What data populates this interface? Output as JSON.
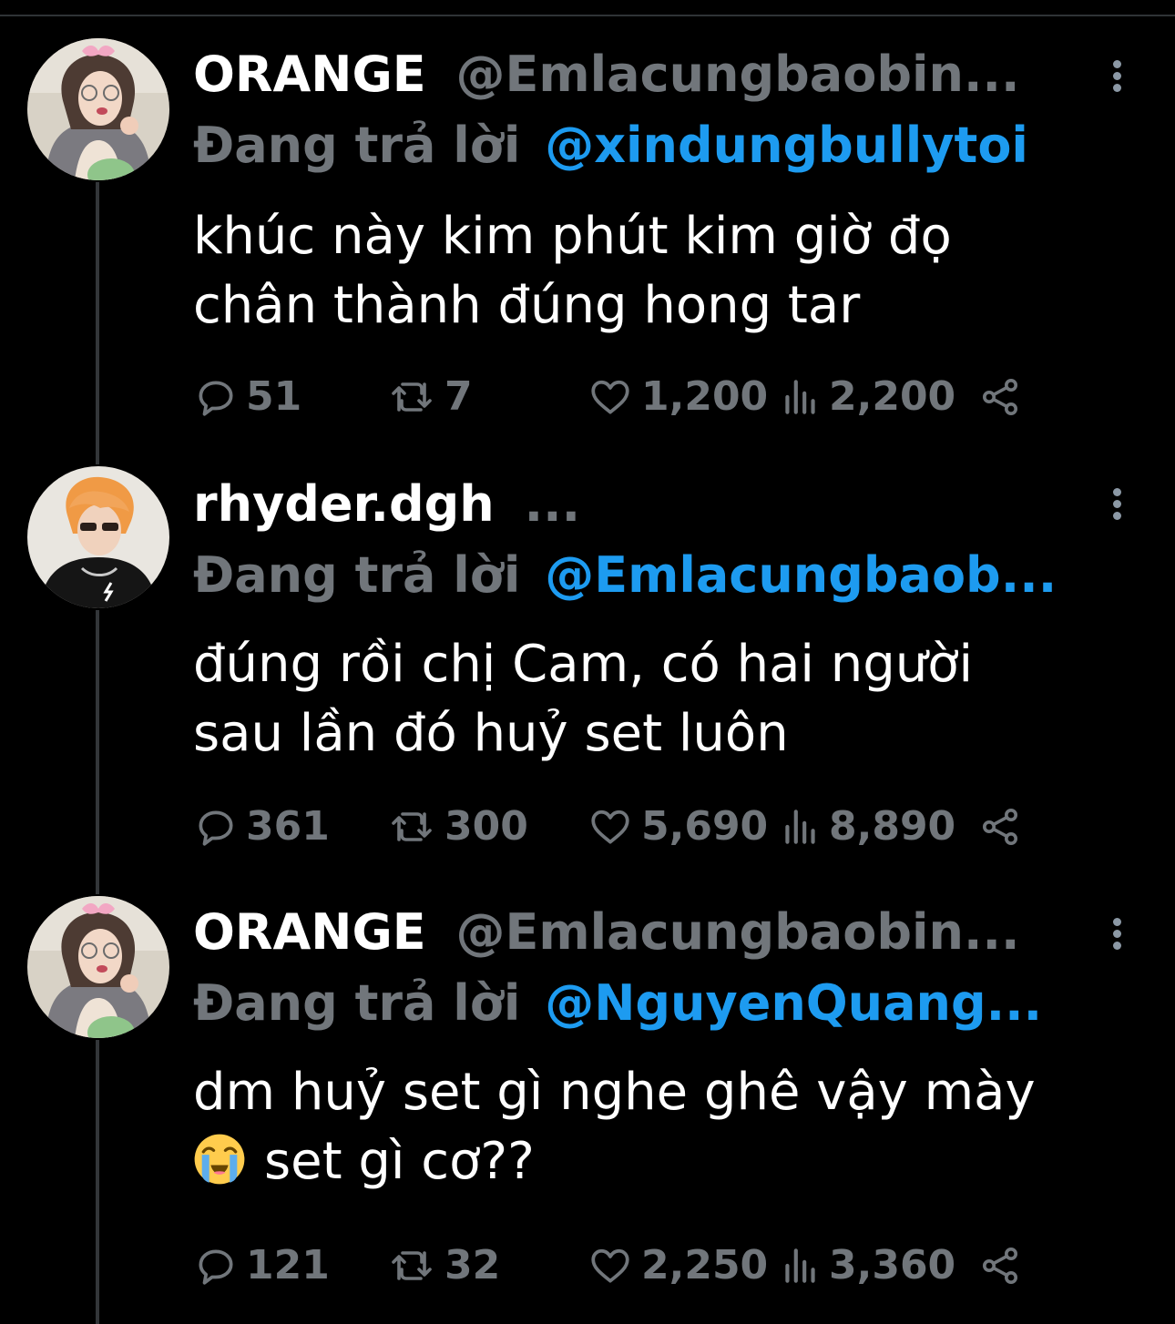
{
  "tweets": [
    {
      "display_name": "ORANGE",
      "handle": "@Emlacungbaobin...",
      "reply_prefix": "Đang trả lời",
      "reply_to": "@xindungbullytoi",
      "text_line1": "khúc này kim phút kim giờ đọ",
      "text_line2": "chân thành đúng hong tar",
      "replies": "51",
      "retweets": "7",
      "likes": "1,200",
      "views": "2,200"
    },
    {
      "display_name": "rhyder.dgh",
      "handle": "...",
      "reply_prefix": "Đang trả lời",
      "reply_to": "@Emlacungbaob...",
      "text_line1": "đúng rồi chị Cam, có hai người",
      "text_line2": "sau lần đó huỷ set luôn",
      "replies": "361",
      "retweets": "300",
      "likes": "5,690",
      "views": "8,890"
    },
    {
      "display_name": "ORANGE",
      "handle": "@Emlacungbaobin...",
      "reply_prefix": "Đang trả lời",
      "reply_to": "@NguyenQuang...",
      "text_line1": "dm huỷ set gì nghe ghê vậy mày",
      "text_line2": "set gì cơ??",
      "replies": "121",
      "retweets": "32",
      "likes": "2,250",
      "views": "3,360"
    }
  ],
  "icons": {
    "reply": "speech-bubble-icon",
    "retweet": "retweet-icon",
    "like": "heart-icon",
    "views": "bar-chart-icon",
    "share": "share-icon",
    "more": "vertical-dots-icon",
    "emoji": "loudly-crying-face-emoji"
  },
  "colors": {
    "background": "#000000",
    "text": "#ffffff",
    "muted": "#71767b",
    "mention": "#1d9bf0",
    "thread_line": "#333639"
  }
}
